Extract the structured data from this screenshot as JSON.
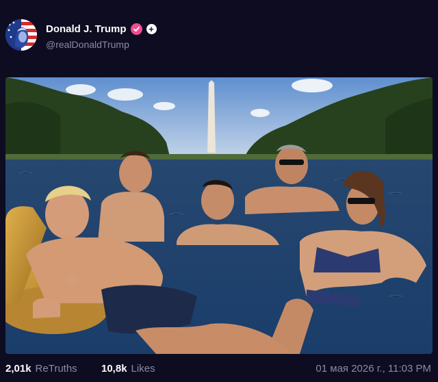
{
  "post": {
    "author": {
      "display_name": "Donald J. Trump",
      "handle": "@realDonaldTrump",
      "verified": true,
      "avatar": "flag-portrait-avatar",
      "add_icon": "plus-icon"
    },
    "media": {
      "description_icon": "pool-photo-image"
    },
    "stats": {
      "retruths_count": "2,01k",
      "retruths_label": "ReTruths",
      "likes_count": "10,8k",
      "likes_label": "Likes"
    },
    "timestamp": "01 мая 2026 г., 11:03 PM"
  },
  "colors": {
    "background": "#0e0c21",
    "verified_badge": "#ef4d8f",
    "muted_text": "#8b8aa6"
  }
}
